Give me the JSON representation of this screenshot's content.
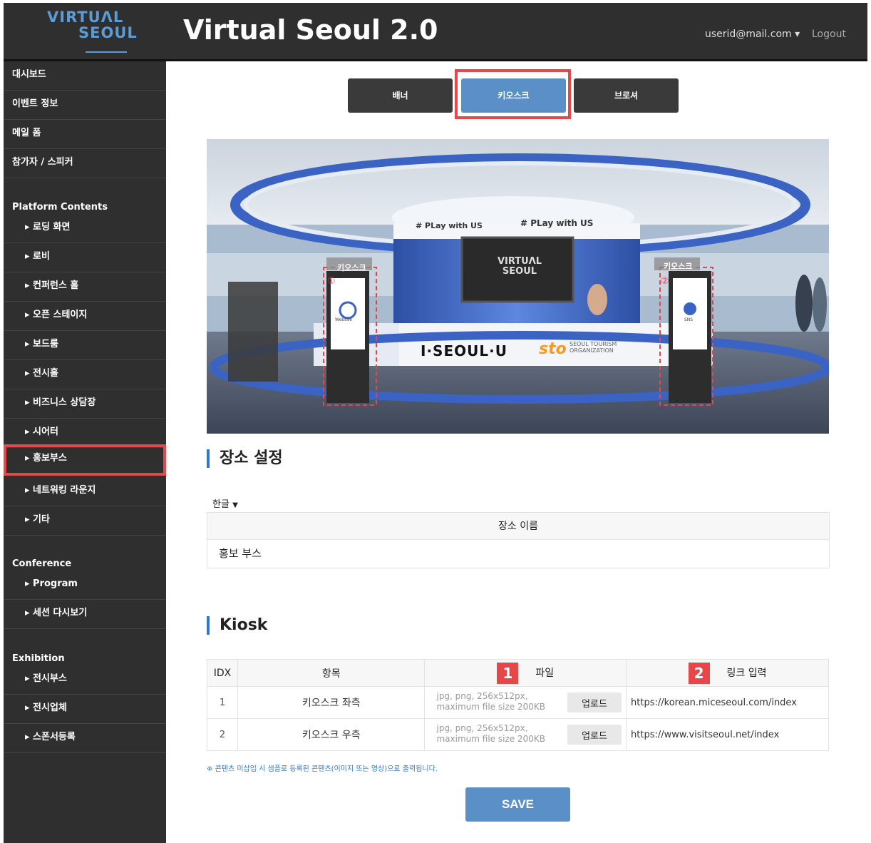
{
  "header": {
    "logo_line1": "VIRTUΛL",
    "logo_line2": "SEOUL",
    "title": "Virtual Seoul 2.0",
    "user": "userid@mail.com ▾",
    "logout": "Logout"
  },
  "sidebar": {
    "top_items": [
      "대시보드",
      "이벤트 정보",
      "메일 폼",
      "참가자 / 스피커"
    ],
    "platform_heading": "Platform Contents",
    "platform_items": [
      "▸ 로딩 화면",
      "▸ 로비",
      "▸ 컨퍼런스 홀",
      "▸ 오픈 스테이지",
      "▸ 보드룸",
      "▸ 전시홀",
      "▸ 비즈니스 상담장",
      "▸ 시어터",
      "▸ 홍보부스",
      "▸ 네트워킹 라운지",
      "▸ 기타"
    ],
    "conference_heading": "Conference",
    "conference_items": [
      "▸ Program",
      "▸ 세션 다시보기"
    ],
    "exhibition_heading": "Exhibition",
    "exhibition_items": [
      "▸ 전시부스",
      "▸ 전시업체",
      "▸ 스폰서등록"
    ]
  },
  "tabs": [
    "배너",
    "키오스크",
    "브로셔"
  ],
  "scene": {
    "kiosk_label_left": "키오스크",
    "kiosk_label_right": "키오스크",
    "marker_left": "①",
    "marker_right": "②",
    "ring_text": "# PLay with US",
    "ring_text2": "# PLay with US",
    "screen_logo": "VIRTUΛL SEOUL",
    "counter_text": "I·SEOUL·U",
    "sto_text": "sto",
    "sto_org": "SEOUL TOURISM ORGANIZATION",
    "kiosk_left_caption": "Website",
    "kiosk_right_caption": "SNS"
  },
  "place": {
    "title": "장소 설정",
    "lang": "한글",
    "column": "장소 이름",
    "value": "홍보 부스"
  },
  "kiosk": {
    "title": "Kiosk",
    "columns": {
      "idx": "IDX",
      "item": "항목",
      "file": "파일",
      "link": "링크 입력"
    },
    "badges": [
      "1",
      "2"
    ],
    "rows": [
      {
        "idx": "1",
        "item": "키오스크 좌측",
        "hint": "jpg, png, 256x512px, maximum file size 200KB",
        "upload": "업로드",
        "link": "https://korean.miceseoul.com/index"
      },
      {
        "idx": "2",
        "item": "키오스크 우측",
        "hint": "jpg, png, 256x512px, maximum file size 200KB",
        "upload": "업로드",
        "link": "https://www.visitseoul.net/index"
      }
    ],
    "note": "※  콘텐츠 미삽입 시 샘플로 등록된 콘텐츠(이미지 또는 영상)으로 출력됩니다.",
    "save": "SAVE"
  },
  "colors": {
    "accent": "#5b8fc7",
    "highlight": "#e8474a",
    "sidebar": "#2f2f2f"
  }
}
